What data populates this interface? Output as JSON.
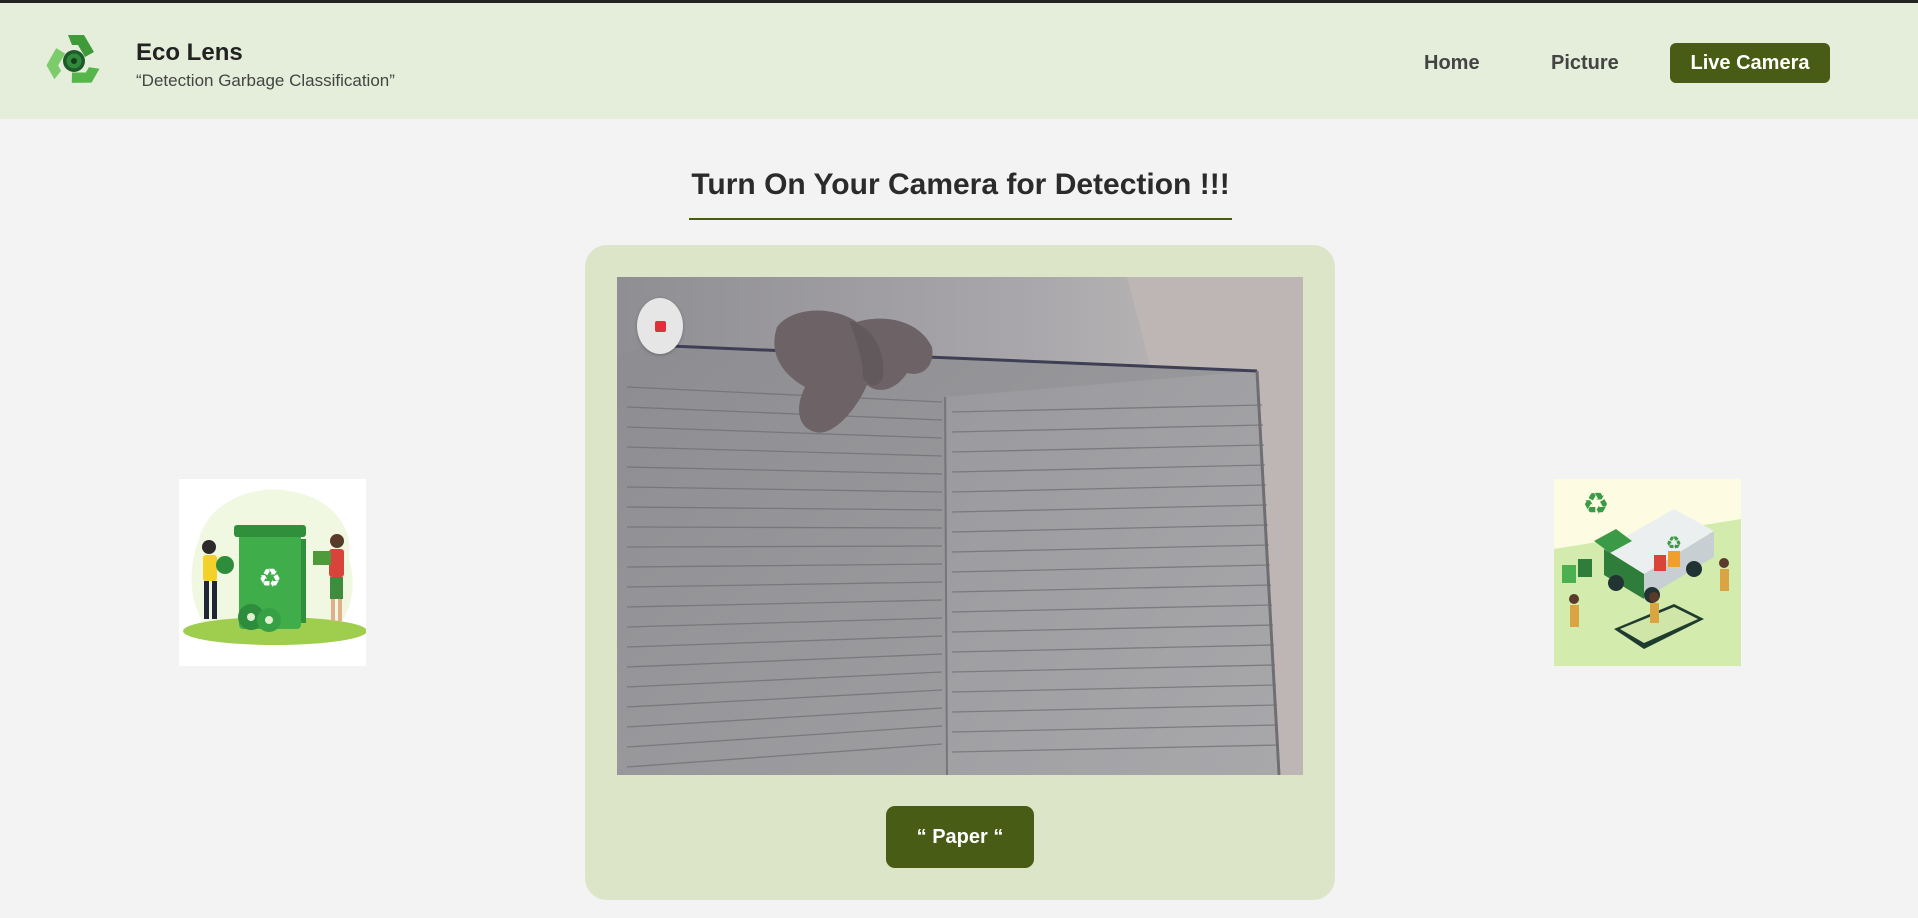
{
  "brand": {
    "title": "Eco Lens",
    "subtitle": "“Detection Garbage Classification”",
    "logo_icon": "recycle-logo-icon"
  },
  "nav": {
    "home": "Home",
    "picture": "Picture",
    "live_camera": "Live Camera",
    "active": "Live Camera"
  },
  "main": {
    "title": "Turn On Your Camera for Detection !!!",
    "record_icon": "stop-record-icon",
    "result_label": "“ Paper “"
  },
  "images": {
    "left": "recycling-people-illustration",
    "right": "waste-truck-sorting-illustration"
  },
  "colors": {
    "navbar_bg": "#e5eedb",
    "accent": "#485c15",
    "card_bg": "#dde5c9",
    "page_bg": "#f3f3f3",
    "record_red": "#e0303a"
  }
}
